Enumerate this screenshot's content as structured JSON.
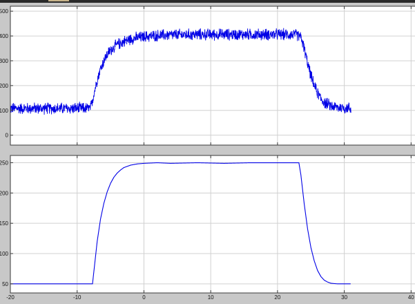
{
  "window": {
    "colors": {
      "window_bg": "#c8c8c8",
      "top_strip": "#2a2a2a",
      "top_strip_accent": "#c8b48a",
      "axes_bg": "#ffffff",
      "grid": "#d0d0d0",
      "axis": "#3a3a3a",
      "trace": "#0000e6"
    }
  },
  "chart_data": [
    {
      "type": "line",
      "title": "",
      "xlabel": "",
      "ylabel": "",
      "xlim": [
        -20,
        41
      ],
      "ylim": [
        -40,
        520
      ],
      "xticks": [
        -20,
        -10,
        0,
        10,
        20,
        30,
        40
      ],
      "yticks": [
        0,
        100,
        200,
        300,
        400,
        500
      ],
      "grid": true,
      "series": [
        {
          "color": "#0000e6",
          "noise_amplitude": 28,
          "x": [
            -20,
            -8,
            -7.5,
            -7,
            -6.5,
            -6,
            -5.5,
            -5,
            -4,
            -3,
            -2,
            -1,
            0,
            2,
            4,
            6,
            8,
            10,
            12,
            14,
            16,
            18,
            20,
            22,
            23,
            23.5,
            24,
            24.5,
            25,
            25.5,
            26,
            26.5,
            27,
            28,
            29,
            30,
            30.5,
            31
          ],
          "values": [
            108,
            108,
            165,
            225,
            268,
            300,
            325,
            343,
            365,
            378,
            388,
            393,
            397,
            402,
            404,
            405,
            406,
            406,
            406,
            406,
            406,
            406,
            406,
            406,
            404,
            395,
            350,
            290,
            240,
            200,
            170,
            148,
            132,
            118,
            112,
            110,
            109,
            109
          ]
        }
      ]
    },
    {
      "type": "line",
      "title": "",
      "xlabel": "",
      "ylabel": "",
      "xlim": [
        -20,
        41
      ],
      "ylim": [
        35,
        262
      ],
      "xticks": [
        -20,
        -10,
        0,
        10,
        20,
        30,
        40
      ],
      "yticks": [
        50,
        100,
        150,
        200,
        250
      ],
      "grid": true,
      "series": [
        {
          "color": "#0000e6",
          "noise_amplitude": 0,
          "x": [
            -20,
            -7.7,
            -7,
            -6.5,
            -6,
            -5.5,
            -5,
            -4.5,
            -4,
            -3.5,
            -3,
            -2.5,
            -2,
            -1.5,
            -1,
            0,
            2,
            4,
            8,
            12,
            16,
            20,
            23.2,
            23.5,
            24,
            24.5,
            25,
            25.5,
            26,
            26.5,
            27,
            27.5,
            28,
            29,
            31
          ],
          "values": [
            50,
            50,
            120,
            157,
            183,
            202,
            216,
            226,
            233,
            238,
            242,
            244,
            246,
            247,
            248,
            249,
            250,
            249,
            250,
            249,
            250,
            250,
            250,
            230,
            182,
            141,
            110,
            88,
            72,
            62,
            56,
            53,
            51,
            50,
            50
          ]
        }
      ]
    }
  ]
}
